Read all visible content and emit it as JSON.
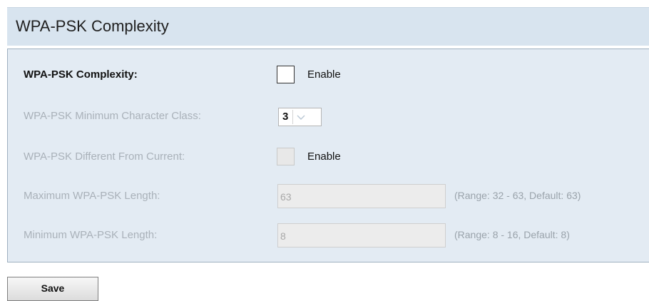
{
  "header": {
    "title": "WPA-PSK Complexity"
  },
  "form": {
    "complexity": {
      "label": "WPA-PSK Complexity:",
      "checkbox_label": "Enable",
      "checked": false
    },
    "min_char_class": {
      "label": "WPA-PSK Minimum Character Class:",
      "selected": "3"
    },
    "different_from_current": {
      "label": "WPA-PSK Different From Current:",
      "checkbox_label": "Enable",
      "checked": false
    },
    "max_length": {
      "label": "Maximum WPA-PSK Length:",
      "value": "63",
      "hint": "(Range: 32 - 63, Default: 63)"
    },
    "min_length": {
      "label": "Minimum WPA-PSK Length:",
      "value": "8",
      "hint": "(Range: 8 - 16, Default: 8)"
    }
  },
  "actions": {
    "save_label": "Save"
  }
}
